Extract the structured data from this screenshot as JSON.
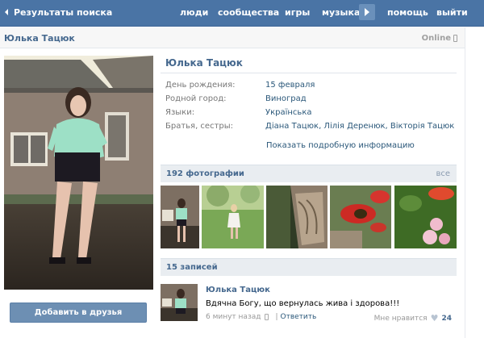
{
  "topbar": {
    "back_label": "Результаты поиска",
    "nav": [
      "люди",
      "сообщества",
      "игры",
      "музыка",
      "помощь",
      "выйти"
    ]
  },
  "profile": {
    "name": "Юлька Тацюк",
    "online": "Online",
    "info": [
      {
        "label": "День рождения:",
        "value": "15 февраля"
      },
      {
        "label": "Родной город:",
        "value": "Виноград"
      },
      {
        "label": "Языки:",
        "value": "Українська"
      },
      {
        "label": "Братья, сестры:",
        "value": "Діана Тацюк, Лілія Деренюк, Вікторія Тацюк"
      }
    ],
    "more_info": "Показать подробную информацию",
    "add_friend": "Добавить в друзья"
  },
  "photos": {
    "title": "192 фотографии",
    "all": "все"
  },
  "wall": {
    "title": "15 записей",
    "post": {
      "author": "Юлька Тацюк",
      "text": "Вдячна Богу, що вернулась жива і здорова!!!",
      "time": "6 минут назад",
      "reply": "Ответить",
      "like_label": "Мне нравится",
      "like_count": "24"
    }
  },
  "colors": {
    "topbar": "#4a74a5",
    "link": "#2b587a",
    "name": "#45688e",
    "section_bg": "#e9edf1"
  }
}
